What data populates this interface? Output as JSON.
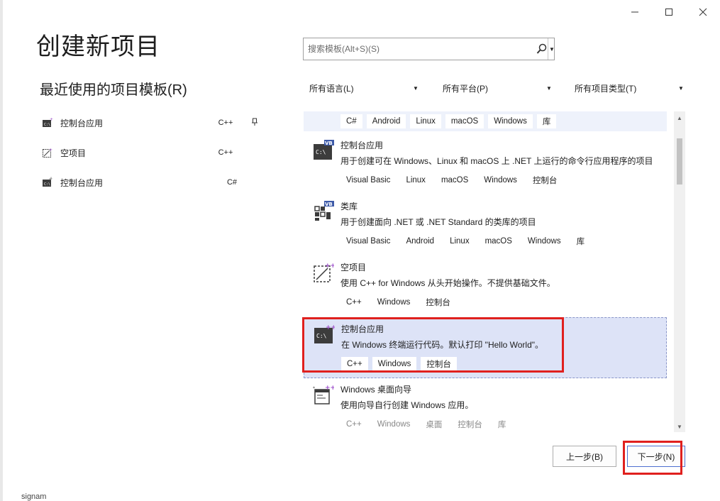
{
  "window": {
    "minimize_icon": "minimize-icon",
    "maximize_icon": "maximize-icon",
    "close_icon": "close-icon"
  },
  "page_title": "创建新项目",
  "recent": {
    "title": "最近使用的项目模板(R)",
    "items": [
      {
        "label": "控制台应用",
        "lang": "C++",
        "pinned": true
      },
      {
        "label": "空项目",
        "lang": "C++",
        "pinned": false
      },
      {
        "label": "控制台应用",
        "lang": "C#",
        "pinned": false
      }
    ]
  },
  "search": {
    "placeholder": "搜索模板(Alt+S)(S)"
  },
  "filters": {
    "language": "所有语言(L)",
    "platform": "所有平台(P)",
    "project_type": "所有项目类型(T)"
  },
  "templates": [
    {
      "name": "",
      "desc": "",
      "tags": [
        "C#",
        "Android",
        "Linux",
        "macOS",
        "Windows",
        "库"
      ],
      "icon": "partial"
    },
    {
      "name": "控制台应用",
      "desc": "用于创建可在 Windows、Linux 和 macOS 上 .NET 上运行的命令行应用程序的项目",
      "tags": [
        "Visual Basic",
        "Linux",
        "macOS",
        "Windows",
        "控制台"
      ],
      "icon": "vb-console-icon"
    },
    {
      "name": "类库",
      "desc": "用于创建面向 .NET 或 .NET Standard 的类库的项目",
      "tags": [
        "Visual Basic",
        "Android",
        "Linux",
        "macOS",
        "Windows",
        "库"
      ],
      "icon": "vb-library-icon"
    },
    {
      "name": "空项目",
      "desc": "使用 C++ for Windows 从头开始操作。不提供基础文件。",
      "tags": [
        "C++",
        "Windows",
        "控制台"
      ],
      "icon": "cpp-empty-icon"
    },
    {
      "name": "控制台应用",
      "desc": "在 Windows 终端运行代码。默认打印 \"Hello World\"。",
      "tags": [
        "C++",
        "Windows",
        "控制台"
      ],
      "icon": "cpp-console-icon"
    },
    {
      "name": "Windows 桌面向导",
      "desc": "使用向导自行创建 Windows 应用。",
      "tags": [
        "C++",
        "Windows",
        "桌面",
        "控制台",
        "库"
      ],
      "icon": "cpp-wizard-icon"
    }
  ],
  "buttons": {
    "back": "上一步(B)",
    "next": "下一步(N)"
  },
  "bottom_text": "signam",
  "colors": {
    "highlight_red": "#e0201e",
    "selected_bg": "#dde3f7",
    "cpp_plus": "#9b4dca",
    "vb_badge": "#3d5aa8"
  }
}
